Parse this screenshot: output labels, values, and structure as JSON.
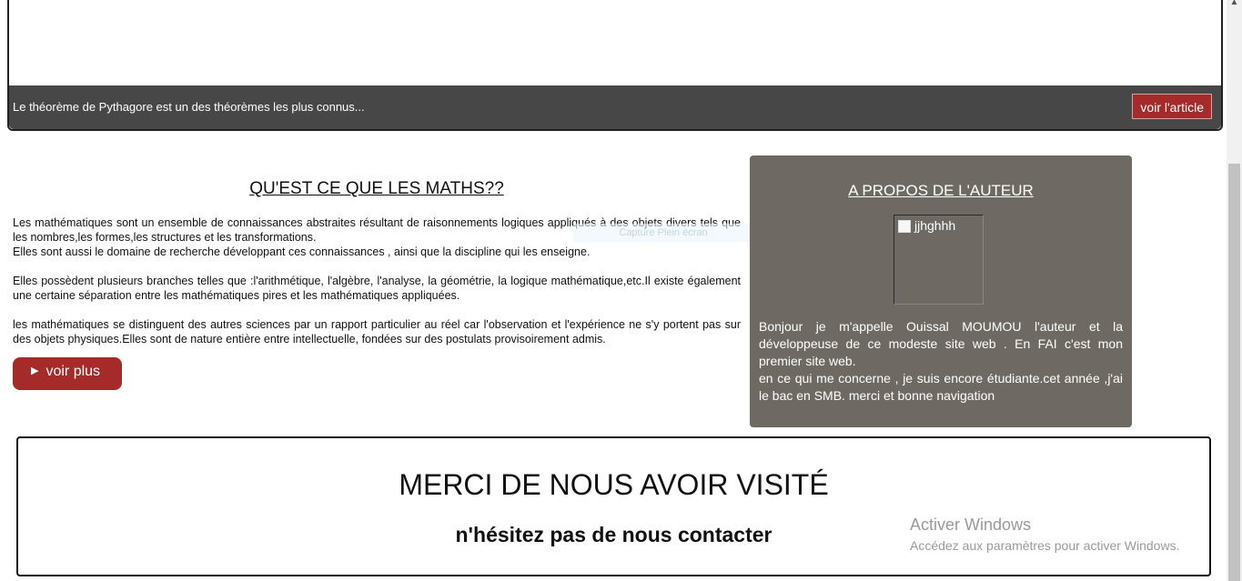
{
  "slider": {
    "caption": "Le théorème de Pythagore est un des théorèmes les plus connus...",
    "article_button": "voir l'article"
  },
  "maths": {
    "title": "QU'EST CE QUE LES MATHS??",
    "paragraphs": [
      "Les mathématiques sont un ensemble de connaissances abstraites résultant de raisonnements logiques appliqués à des objets divers tels que les nombres,les formes,les structures et les transformations.",
      "Elles sont aussi le domaine de recherche développant ces connaissances , ainsi que la discipline qui les enseigne.",
      "Elles possèdent plusieurs branches telles que :l'arithmétique, l'algèbre, l'analyse, la géométrie, la logique mathématique,etc.Il existe également une certaine séparation entre les mathématiques pires et les mathématiques appliquées.",
      "les mathématiques se distinguent des autres sciences par un rapport particulier au réel car l'observation et l'expérience ne s'y portent pas sur des objets physiques.Elles sont de nature entière entre intellectuelle, fondées sur des postulats provisoirement admis."
    ],
    "more_button": "voir plus",
    "capture_overlay": "Capture Plein écran"
  },
  "author": {
    "title": "A PROPOS DE L'AUTEUR",
    "image_alt": "jjhghhh",
    "bio_line1": "Bonjour je m'appelle Ouissal MOUMOU l'auteur et la développeuse de ce modeste site web . En FAI c'est mon premier site web.",
    "bio_line2": "en ce qui me concerne , je suis encore étudiante.cet année ,j'ai le bac en SMB. merci et bonne navigation"
  },
  "footer": {
    "title": "MERCI DE NOUS AVOIR VISITÉ",
    "subtitle": "n'hésitez pas de nous contacter"
  },
  "watermark": {
    "title": "Activer Windows",
    "subtitle": "Accédez aux paramètres pour activer Windows."
  }
}
